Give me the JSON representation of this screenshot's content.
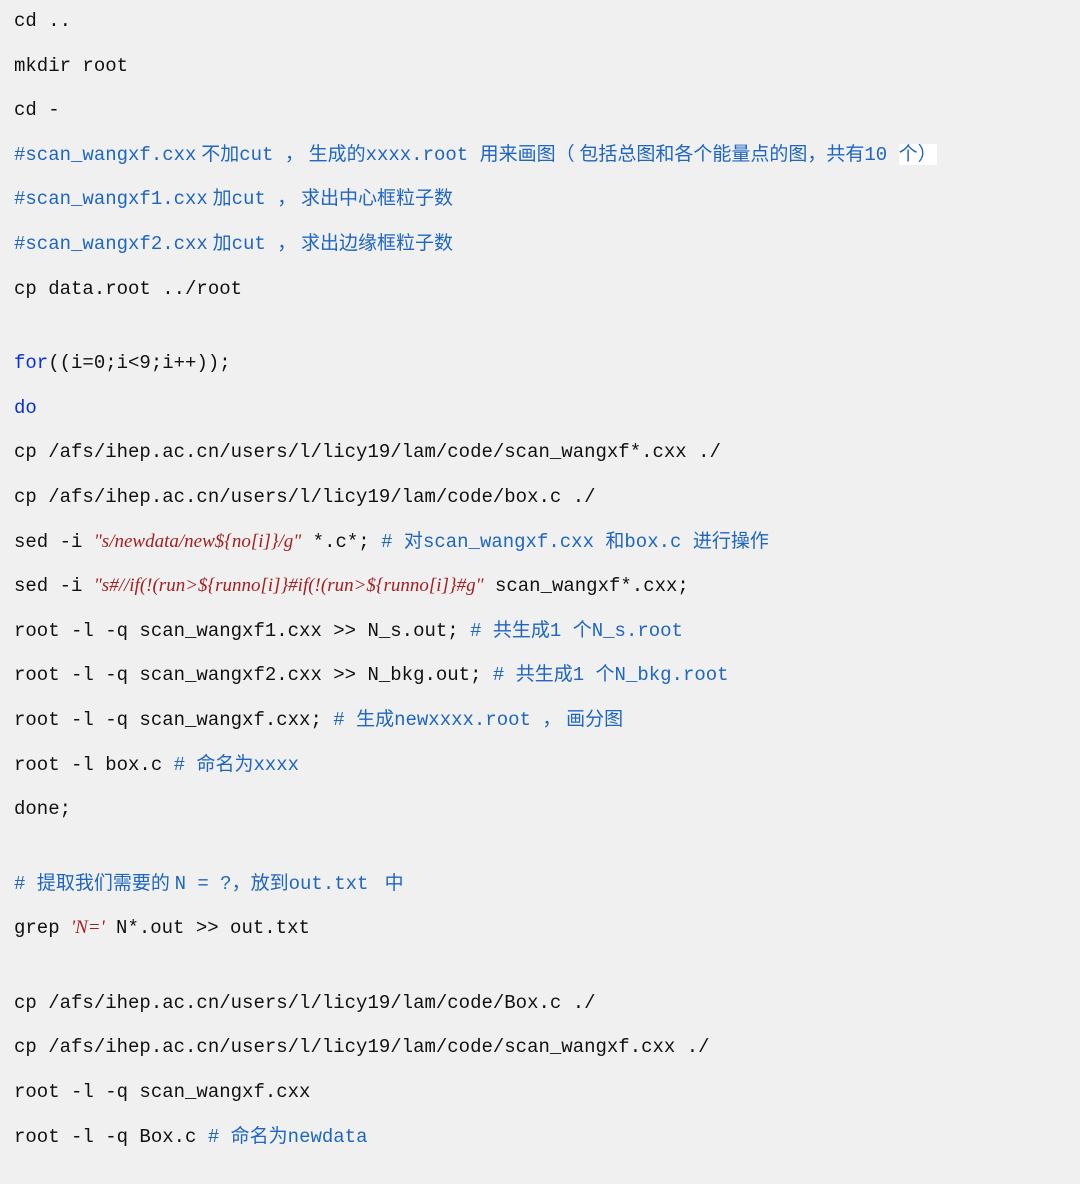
{
  "lines": {
    "l01": "cd ..",
    "l02": "mkdir root",
    "l03": "cd -",
    "l04a": "#scan_wangxf.cxx",
    "l04b": " 不加",
    "l04c": "cut ",
    "l04d": "， 生成的",
    "l04e": "xxxx.root ",
    "l04f": "用来画图（ 包括总图和各个能量点的图，共有",
    "l04g": "10 ",
    "l04h": "个）",
    "l05a": "#scan_wangxf1.cxx",
    "l05b": " 加",
    "l05c": "cut ",
    "l05d": "， 求出中心框粒子数",
    "l06a": "#scan_wangxf2.cxx",
    "l06b": " 加",
    "l06c": "cut ",
    "l06d": "， 求出边缘框粒子数",
    "l07": "cp data.root ../root",
    "l08a": "for",
    "l08b": "((i=0;i<9;i++));",
    "l09": "do",
    "l10": "cp /afs/ihep.ac.cn/users/l/licy19/lam/code/scan_wangxf*.cxx ./",
    "l11": "cp /afs/ihep.ac.cn/users/l/licy19/lam/code/box.c ./",
    "l12a": "sed -i ",
    "l12b": "\"s/newdata/new${no[i]}/g\"",
    "l12c": " *.c*; ",
    "l12d": "# ",
    "l12e": "对",
    "l12f": "scan_wangxf.cxx ",
    "l12g": "和",
    "l12h": "box.c ",
    "l12i": "进行操作",
    "l13a": "sed -i ",
    "l13b": "\"s#//if(!(run>${runno[i]}#if(!(run>${runno[i]}#g\"",
    "l13c": " scan_wangxf*.cxx;",
    "l14a": "root -l -q scan_wangxf1.cxx >> N_s.out; ",
    "l14b": "# ",
    "l14c": "共生成",
    "l14d": "1 ",
    "l14e": "个",
    "l14f": "N_s.root",
    "l15a": "root -l -q scan_wangxf2.cxx >> N_bkg.out; ",
    "l15b": "# ",
    "l15c": "共生成",
    "l15d": "1 ",
    "l15e": "个",
    "l15f": "N_bkg.root",
    "l16a": "root -l -q scan_wangxf.cxx; ",
    "l16b": "# ",
    "l16c": "生成",
    "l16d": "newxxxx.root ",
    "l16e": "， 画分图",
    "l17a": "root -l box.c ",
    "l17b": "# ",
    "l17c": "命名为",
    "l17d": "xxxx",
    "l18": "done;",
    "l19a": "# ",
    "l19b": "提取我们需要的 ",
    "l19c": "N = ?",
    "l19d": "，放到",
    "l19e": "out.txt ",
    "l19f": " 中",
    "l20a": "grep ",
    "l20b": "'N='",
    "l20c": " N*.out >> out.txt",
    "l21": "cp /afs/ihep.ac.cn/users/l/licy19/lam/code/Box.c ./",
    "l22": "cp /afs/ihep.ac.cn/users/l/licy19/lam/code/scan_wangxf.cxx ./",
    "l23": "root -l -q scan_wangxf.cxx",
    "l24a": "root -l -q Box.c ",
    "l24b": "# ",
    "l24c": "命名为",
    "l24d": "newdata"
  }
}
